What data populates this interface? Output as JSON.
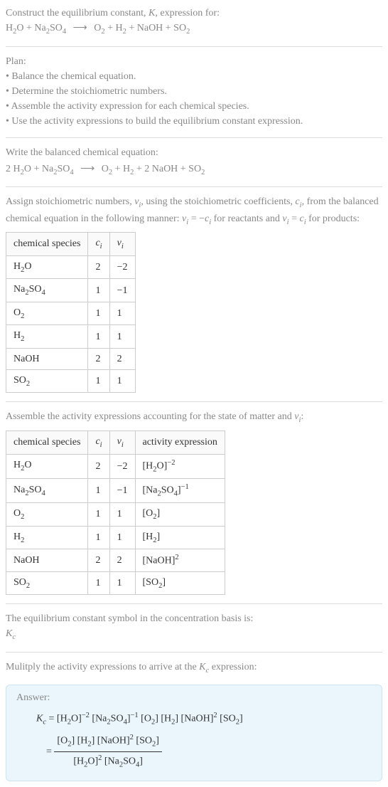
{
  "header": {
    "lead": "Construct the equilibrium constant, ",
    "K": "K",
    "lead2": ", expression for:",
    "eq_lhs_1": "H",
    "eq_lhs_1s": "2",
    "eq_lhs_1b": "O + Na",
    "eq_lhs_1c": "2",
    "eq_lhs_1d": "SO",
    "eq_lhs_1e": "4",
    "arrow": "⟶",
    "eq_rhs_1": "O",
    "eq_rhs_1s": "2",
    "eq_rhs_2": " + H",
    "eq_rhs_2s": "2",
    "eq_rhs_3": " + NaOH + SO",
    "eq_rhs_3s": "2"
  },
  "plan": {
    "title": "Plan:",
    "items": [
      "• Balance the chemical equation.",
      "• Determine the stoichiometric numbers.",
      "• Assemble the activity expression for each chemical species.",
      "• Use the activity expressions to build the equilibrium constant expression."
    ]
  },
  "balanced": {
    "title": "Write the balanced chemical equation:",
    "lhs1a": "2 H",
    "lhs1b": "2",
    "lhs1c": "O + Na",
    "lhs1d": "2",
    "lhs1e": "SO",
    "lhs1f": "4",
    "arrow": "⟶",
    "rhs1a": "O",
    "rhs1b": "2",
    "rhs1c": " + H",
    "rhs1d": "2",
    "rhs1e": " + 2 NaOH + SO",
    "rhs1f": "2"
  },
  "assign": {
    "p1a": "Assign stoichiometric numbers, ",
    "p1b": "ν",
    "p1bi": "i",
    "p1c": ", using the stoichiometric coefficients, ",
    "p1d": "c",
    "p1di": "i",
    "p1e": ", from the balanced chemical equation in the following manner: ",
    "p1f": "ν",
    "p1fi": "i",
    "p1g": " = −",
    "p1h": "c",
    "p1hi": "i",
    "p1i": " for reactants and ",
    "p1j": "ν",
    "p1ji": "i",
    "p1k": " = ",
    "p1l": "c",
    "p1li": "i",
    "p1m": " for products:",
    "table": {
      "head": [
        "chemical species",
        "c_i",
        "ν_i"
      ],
      "rows": [
        {
          "sp_a": "H",
          "sp_b": "2",
          "sp_c": "O",
          "c": "2",
          "v": "−2"
        },
        {
          "sp_a": "Na",
          "sp_b": "2",
          "sp_c": "SO",
          "sp_d": "4",
          "c": "1",
          "v": "−1"
        },
        {
          "sp_a": "O",
          "sp_b": "2",
          "sp_c": "",
          "c": "1",
          "v": "1"
        },
        {
          "sp_a": "H",
          "sp_b": "2",
          "sp_c": "",
          "c": "1",
          "v": "1"
        },
        {
          "sp_a": "NaOH",
          "sp_b": "",
          "sp_c": "",
          "c": "2",
          "v": "2"
        },
        {
          "sp_a": "SO",
          "sp_b": "2",
          "sp_c": "",
          "c": "1",
          "v": "1"
        }
      ]
    }
  },
  "assemble": {
    "title_a": "Assemble the activity expressions accounting for the state of matter and ",
    "title_b": "ν",
    "title_bi": "i",
    "title_c": ":",
    "table": {
      "head": [
        "chemical species",
        "c_i",
        "ν_i",
        "activity expression"
      ],
      "rows": [
        {
          "sp_a": "H",
          "sp_b": "2",
          "sp_c": "O",
          "c": "2",
          "v": "−2",
          "act_a": "[H",
          "act_b": "2",
          "act_c": "O]",
          "act_exp": "−2"
        },
        {
          "sp_a": "Na",
          "sp_b": "2",
          "sp_c": "SO",
          "sp_d": "4",
          "c": "1",
          "v": "−1",
          "act_a": "[Na",
          "act_b": "2",
          "act_c": "SO",
          "act_d": "4",
          "act_e": "]",
          "act_exp": "−1"
        },
        {
          "sp_a": "O",
          "sp_b": "2",
          "sp_c": "",
          "c": "1",
          "v": "1",
          "act_a": "[O",
          "act_b": "2",
          "act_c": "]",
          "act_exp": ""
        },
        {
          "sp_a": "H",
          "sp_b": "2",
          "sp_c": "",
          "c": "1",
          "v": "1",
          "act_a": "[H",
          "act_b": "2",
          "act_c": "]",
          "act_exp": ""
        },
        {
          "sp_a": "NaOH",
          "sp_b": "",
          "sp_c": "",
          "c": "2",
          "v": "2",
          "act_a": "[NaOH]",
          "act_b": "",
          "act_c": "",
          "act_exp": "2"
        },
        {
          "sp_a": "SO",
          "sp_b": "2",
          "sp_c": "",
          "c": "1",
          "v": "1",
          "act_a": "[SO",
          "act_b": "2",
          "act_c": "]",
          "act_exp": ""
        }
      ]
    }
  },
  "kc_symbol": {
    "line1": "The equilibrium constant symbol in the concentration basis is:",
    "K": "K",
    "c": "c"
  },
  "multiply": {
    "line_a": "Mulitply the activity expressions to arrive at the ",
    "K": "K",
    "c": "c",
    "line_b": " expression:"
  },
  "answer": {
    "label": "Answer:",
    "K": "K",
    "c": "c",
    "eq": " = ",
    "l1": {
      "a": "[H",
      "b": "2",
      "c": "O]",
      "e1": "−2",
      "d": " [Na",
      "e": "2",
      "f": "SO",
      "g": "4",
      "h": "]",
      "e2": "−1",
      "i": " [O",
      "j": "2",
      "k": "] [H",
      "l": "2",
      "m": "] [NaOH]",
      "e3": "2",
      "n": " [SO",
      "o": "2",
      "p": "]"
    },
    "eq2": "= ",
    "num": {
      "a": "[O",
      "b": "2",
      "c": "] [H",
      "d": "2",
      "e": "] [NaOH]",
      "e1": "2",
      "f": " [SO",
      "g": "2",
      "h": "]"
    },
    "den": {
      "a": "[H",
      "b": "2",
      "c": "O]",
      "e1": "2",
      "d": " [Na",
      "e": "2",
      "f": "SO",
      "g": "4",
      "h": "]"
    }
  }
}
